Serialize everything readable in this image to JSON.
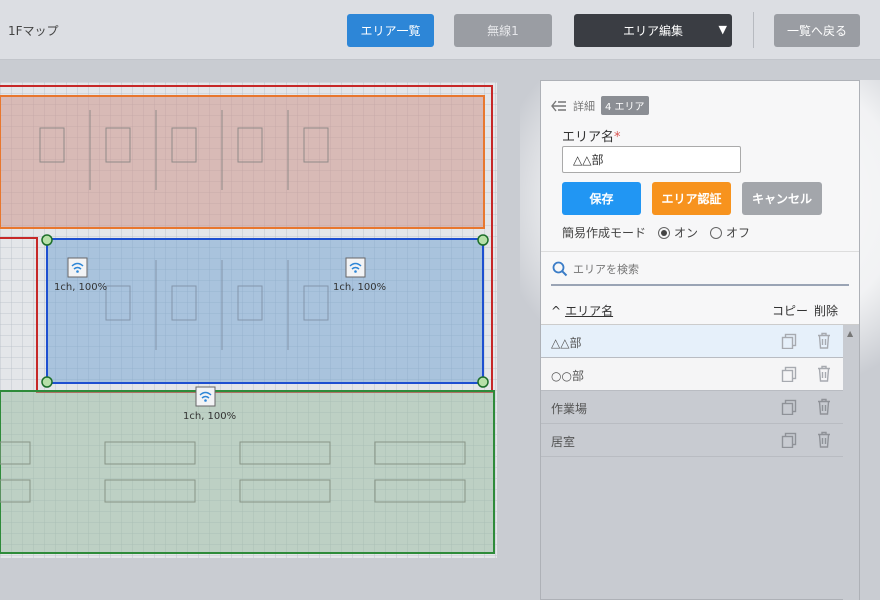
{
  "header": {
    "title": "1Fマップ",
    "area_list_label": "エリア一覧",
    "wireless_label": "無線1",
    "area_edit_label": "エリア編集",
    "back_label": "一覧へ戻る"
  },
  "map": {
    "access_points": [
      {
        "label": "1ch, 100%"
      },
      {
        "label": "1ch, 100%"
      },
      {
        "label": "1ch, 100%"
      }
    ],
    "zone_colors": {
      "red": "#c62828",
      "orange": "#e8772e",
      "blue": "#1e4fd0",
      "green": "#2e8b3a"
    }
  },
  "panel": {
    "detail_label": "詳細",
    "count_badge": "4 エリア",
    "field_label": "エリア名",
    "required_mark": "*",
    "name_value": "△△部",
    "save_label": "保存",
    "auth_label": "エリア認証",
    "cancel_label": "キャンセル",
    "mode_label": "簡易作成モード",
    "mode_on": "オン",
    "mode_off": "オフ",
    "mode_selected": "オン",
    "search_placeholder": "エリアを検索",
    "sort_glyph": "^",
    "col_name": "エリア名",
    "col_copy": "コピー",
    "col_delete": "削除",
    "areas": [
      {
        "name": "△△部"
      },
      {
        "name": "○○部"
      },
      {
        "name": "作業場"
      },
      {
        "name": "居室"
      }
    ]
  },
  "colors": {
    "primary": "#2196f3",
    "accent": "#f7931e",
    "dark": "#3a3d43"
  }
}
